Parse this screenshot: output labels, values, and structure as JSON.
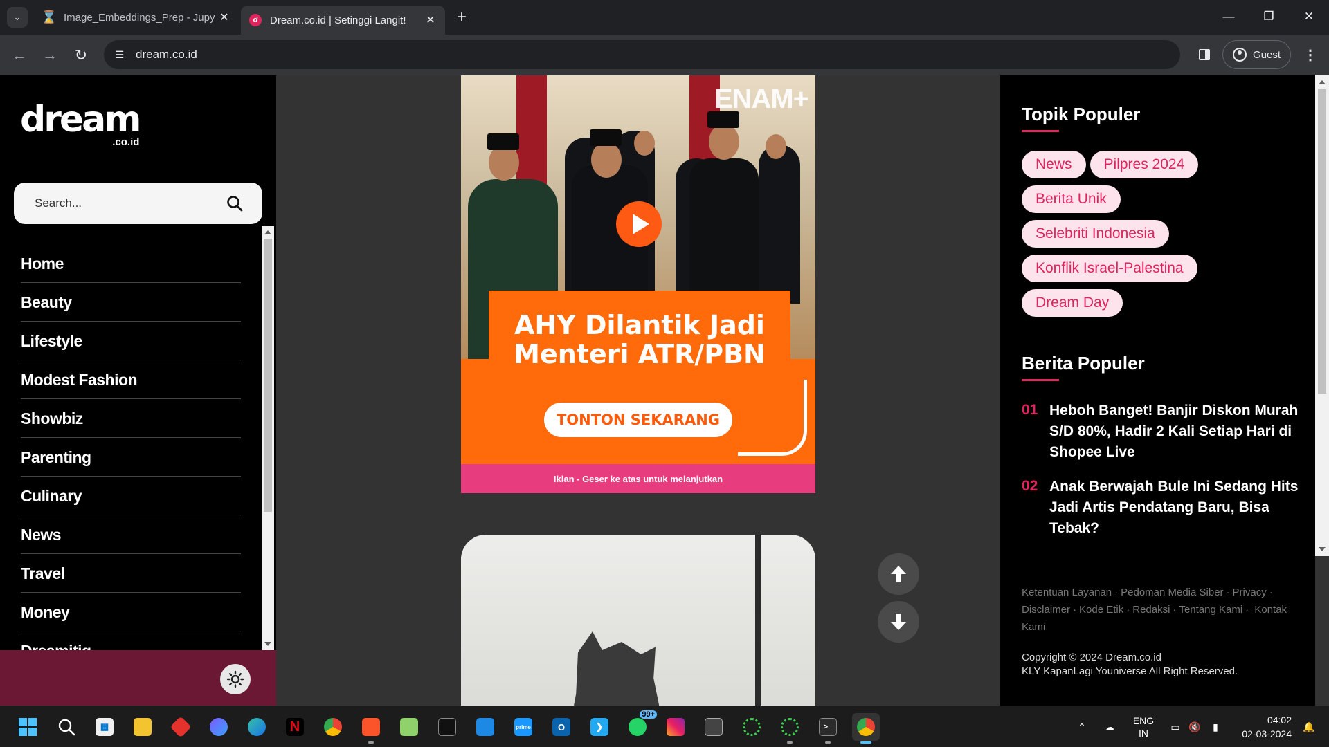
{
  "browser": {
    "tabs": [
      {
        "title": "Image_Embeddings_Prep - Jupy",
        "icon": "jupyter-hourglass-icon"
      },
      {
        "title": "Dream.co.id | Setinggi Langit!",
        "icon": "dream-favicon-icon"
      }
    ],
    "url": "dream.co.id",
    "profile_label": "Guest"
  },
  "site": {
    "logo_main": "dream",
    "logo_sub": ".co.id",
    "search_placeholder": "Search...",
    "menu": [
      "Home",
      "Beauty",
      "Lifestyle",
      "Modest Fashion",
      "Showbiz",
      "Parenting",
      "Culinary",
      "News",
      "Travel",
      "Money",
      "Dreamitiq"
    ]
  },
  "ad": {
    "brand": "ENAM+",
    "headline": "AHY Dilantik Jadi Menteri ATR/PBN",
    "cta": "TONTON SEKARANG",
    "notice": "Iklan - Geser ke atas untuk melanjutkan"
  },
  "right": {
    "topics_title": "Topik Populer",
    "topics": [
      "News",
      "Pilpres 2024",
      "Berita Unik",
      "Selebriti Indonesia",
      "Konflik Israel-Palestina",
      "Dream Day"
    ],
    "popular_title": "Berita Populer",
    "popular": [
      {
        "num": "01",
        "title": "Heboh Banget! Banjir Diskon Murah S/D 80%, Hadir 2 Kali Setiap Hari di Shopee Live"
      },
      {
        "num": "02",
        "title": "Anak Berwajah Bule Ini Sedang Hits Jadi Artis Pendatang Baru, Bisa Tebak?"
      }
    ],
    "footer_links": [
      "Ketentuan Layanan",
      "Pedoman Media Siber",
      "Privacy",
      "Disclaimer",
      "Kode Etik",
      "Redaksi",
      "Tentang Kami",
      "Kontak Kami"
    ],
    "copyright_line1": "Copyright © 2024 Dream.co.id",
    "copyright_line2": "KLY KapanLagi Youniverse All Right Reserved."
  },
  "taskbar": {
    "lang_top": "ENG",
    "lang_bottom": "IN",
    "time": "04:02",
    "date": "02-03-2024",
    "whatsapp_badge": "99+"
  },
  "colors": {
    "accent_pink": "#e0245e",
    "chip_bg": "#fde3ec",
    "ad_orange": "#ff6a0a",
    "footer_maroon": "#6b1834"
  }
}
